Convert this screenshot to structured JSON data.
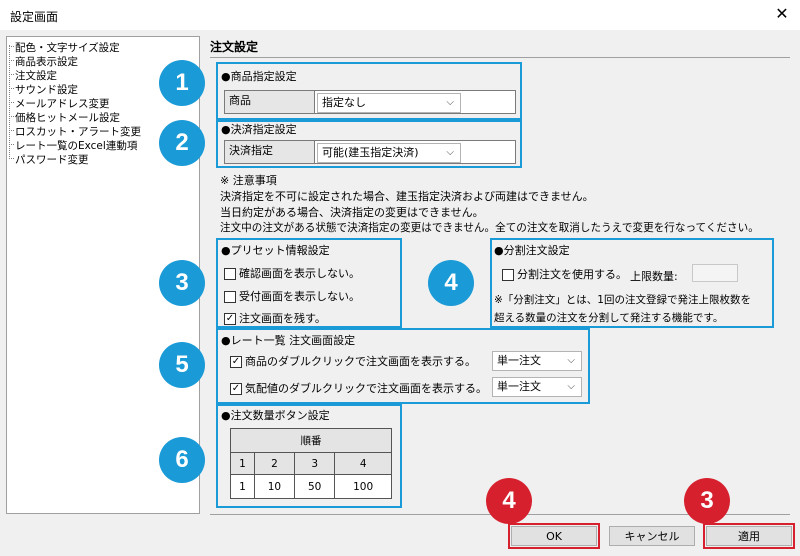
{
  "window": {
    "title": "設定画面",
    "close_glyph": "✕"
  },
  "tree": {
    "items": [
      "配色・文字サイズ設定",
      "商品表示設定",
      "注文設定",
      "サウンド設定",
      "メールアドレス変更",
      "価格ヒットメール設定",
      "ロスカット・アラート変更",
      "レート一覧のExcel連動項",
      "パスワード変更"
    ]
  },
  "page": {
    "title": "注文設定"
  },
  "product": {
    "heading": "●商品指定設定",
    "label": "商品",
    "value": "指定なし"
  },
  "settlement": {
    "heading": "●決済指定設定",
    "label": "決済指定",
    "value": "可能(建玉指定決済)"
  },
  "notes": {
    "title": "※ 注意事項",
    "lines": [
      "決済指定を不可に設定された場合、建玉指定決済および両建はできません。",
      "当日約定がある場合、決済指定の変更はできません。",
      "注文中の注文がある状態で決済指定の変更はできません。全ての注文を取消したうえで変更を行なってください。"
    ]
  },
  "preset": {
    "heading": "●プリセット情報設定",
    "options": [
      {
        "label": "確認画面を表示しない。",
        "checked": ""
      },
      {
        "label": "受付画面を表示しない。",
        "checked": ""
      },
      {
        "label": "注文画面を残す。",
        "checked": "✓"
      }
    ]
  },
  "split": {
    "heading": "●分割注文設定",
    "use_label": "分割注文を使用する。",
    "limit_label": "上限数量:",
    "limit_value": "",
    "desc1": "※「分割注文」とは、1回の注文登録で発注上限枚数を",
    "desc2": "超える数量の注文を分割して発注する機能です。"
  },
  "rate": {
    "heading": "●レート一覧  注文画面設定",
    "rows": [
      {
        "label": "商品のダブルクリックで注文画面を表示する。",
        "checked": "✓",
        "value": "単一注文"
      },
      {
        "label": "気配値のダブルクリックで注文画面を表示する。",
        "checked": "✓",
        "value": "単一注文"
      }
    ]
  },
  "qty": {
    "heading": "●注文数量ボタン設定",
    "header": "順番",
    "cols": [
      "1",
      "2",
      "3",
      "4"
    ],
    "values": [
      "1",
      "10",
      "50",
      "100"
    ]
  },
  "badges": {
    "b1": "1",
    "b2": "2",
    "b3": "3",
    "b4": "4",
    "b5": "5",
    "b6": "6",
    "r4": "4",
    "r3": "3"
  },
  "buttons": {
    "ok": "OK",
    "cancel": "キャンセル",
    "apply": "適用"
  },
  "colors": {
    "annotation_blue": "#1a9ad6",
    "annotation_red": "#d6202e"
  }
}
